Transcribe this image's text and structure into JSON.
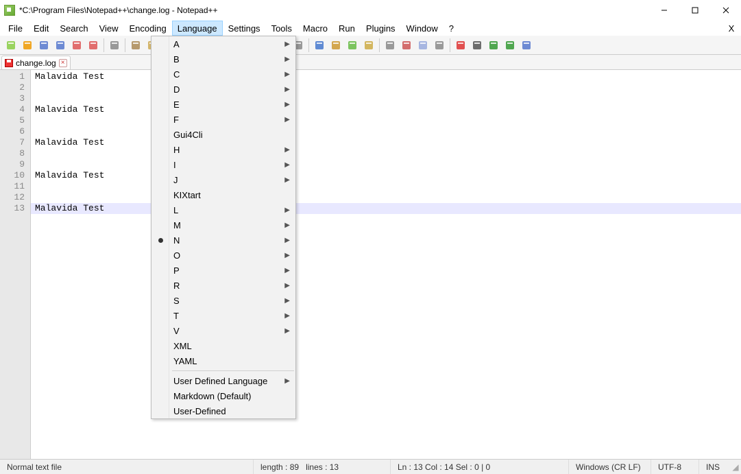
{
  "window": {
    "title": "*C:\\Program Files\\Notepad++\\change.log - Notepad++"
  },
  "menubar": {
    "items": [
      "File",
      "Edit",
      "Search",
      "View",
      "Encoding",
      "Language",
      "Settings",
      "Tools",
      "Macro",
      "Run",
      "Plugins",
      "Window",
      "?"
    ],
    "active_index": 5
  },
  "toolbar_icons": [
    "new",
    "open",
    "save",
    "save-all",
    "close",
    "close-all",
    "print",
    "cut",
    "copy",
    "paste",
    "undo",
    "redo",
    "find",
    "replace",
    "zoom-in",
    "zoom-out",
    "sync",
    "wordwrap",
    "show-all",
    "indent-guide",
    "folder",
    "udl",
    "doc-map",
    "func-list",
    "monitoring",
    "record",
    "stop",
    "play",
    "play-multi",
    "save-macro"
  ],
  "tab": {
    "label": "change.log"
  },
  "editor": {
    "lines": [
      "Malavida Test",
      "",
      "",
      "Malavida Test",
      "",
      "",
      "Malavida Test",
      "",
      "",
      "Malavida Test",
      "",
      "",
      "Malavida Test"
    ],
    "current_line_index": 12
  },
  "language_menu": {
    "groups": [
      [
        {
          "label": "A",
          "submenu": true
        },
        {
          "label": "B",
          "submenu": true
        },
        {
          "label": "C",
          "submenu": true
        },
        {
          "label": "D",
          "submenu": true
        },
        {
          "label": "E",
          "submenu": true
        },
        {
          "label": "F",
          "submenu": true
        },
        {
          "label": "Gui4Cli",
          "submenu": false
        },
        {
          "label": "H",
          "submenu": true
        },
        {
          "label": "I",
          "submenu": true
        },
        {
          "label": "J",
          "submenu": true
        },
        {
          "label": "KIXtart",
          "submenu": false
        },
        {
          "label": "L",
          "submenu": true
        },
        {
          "label": "M",
          "submenu": true
        },
        {
          "label": "N",
          "submenu": true,
          "checked": true
        },
        {
          "label": "O",
          "submenu": true
        },
        {
          "label": "P",
          "submenu": true
        },
        {
          "label": "R",
          "submenu": true
        },
        {
          "label": "S",
          "submenu": true
        },
        {
          "label": "T",
          "submenu": true
        },
        {
          "label": "V",
          "submenu": true
        },
        {
          "label": "XML",
          "submenu": false
        },
        {
          "label": "YAML",
          "submenu": false
        }
      ],
      [
        {
          "label": "User Defined Language",
          "submenu": true
        },
        {
          "label": "Markdown (Default)",
          "submenu": false
        },
        {
          "label": "User-Defined",
          "submenu": false
        }
      ]
    ]
  },
  "statusbar": {
    "filetype": "Normal text file",
    "length_label": "length : 89",
    "lines_label": "lines : 13",
    "position": "Ln : 13    Col : 14    Sel : 0 | 0",
    "eol": "Windows (CR LF)",
    "encoding": "UTF-8",
    "insert_mode": "INS"
  }
}
